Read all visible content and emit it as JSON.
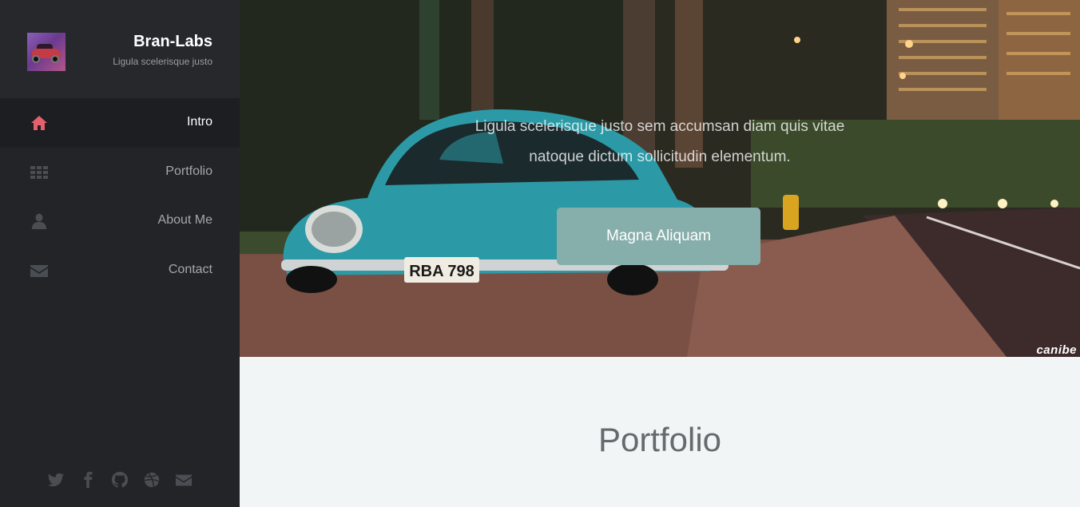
{
  "sidebar": {
    "brand_title": "Bran-Labs",
    "brand_subtitle": "Ligula scelerisque justo",
    "nav": [
      {
        "label": "Intro",
        "icon": "home-icon",
        "active": true
      },
      {
        "label": "Portfolio",
        "icon": "grid-icon",
        "active": false
      },
      {
        "label": "About Me",
        "icon": "user-icon",
        "active": false
      },
      {
        "label": "Contact",
        "icon": "envelope-icon",
        "active": false
      }
    ],
    "social": [
      "twitter-icon",
      "facebook-icon",
      "github-icon",
      "dribbble-icon",
      "envelope-icon"
    ]
  },
  "hero": {
    "text": "Ligula scelerisque justo sem accumsan diam quis vitae natoque dictum sollicitudin elementum.",
    "button_label": "Magna Aliquam",
    "plate_text": "RBA 798",
    "watermark": "canibe"
  },
  "portfolio": {
    "title": "Portfolio"
  },
  "colors": {
    "sidebar_bg": "#222428",
    "active_icon": "#e4606d",
    "inactive_icon": "#4a4d52",
    "button_bg": "#86aeab",
    "section_bg": "#f1f5f5"
  }
}
